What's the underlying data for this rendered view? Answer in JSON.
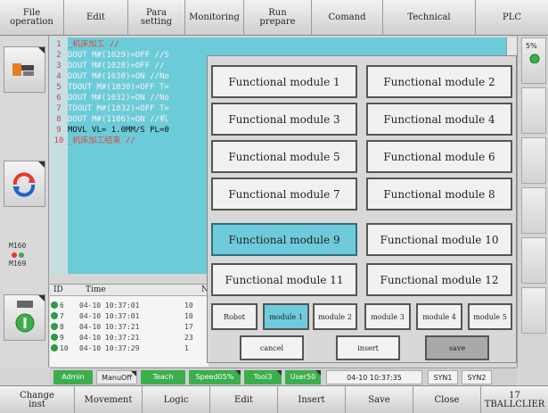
{
  "menu": [
    {
      "label": "File operation"
    },
    {
      "label": "Edit"
    },
    {
      "label": "Para\nsetting"
    },
    {
      "label": "Monitoring"
    },
    {
      "label": "Run\nprepare"
    },
    {
      "label": "Comand"
    },
    {
      "label": "Technical"
    },
    {
      "label": "PLC"
    }
  ],
  "left_tools": {
    "counter_top": "M160",
    "counter_bottom": "M169"
  },
  "right_col": {
    "speed": "5%"
  },
  "program": {
    "lines": [
      {
        "no": "1",
        "code": "_机床加工 //",
        "red": true
      },
      {
        "no": "2",
        "code": "DOUT M#(1029)=OFF //S"
      },
      {
        "no": "3",
        "code": "DOUT M#(1028)=OFF //"
      },
      {
        "no": "4",
        "code": "DOUT M#(1030)=ON //No"
      },
      {
        "no": "5",
        "code": "TDOUT M#(1030)=OFF T="
      },
      {
        "no": "6",
        "code": "DOUT M#(1032)=ON //No"
      },
      {
        "no": "7",
        "code": "TDOUT M#(1032)=OFF T="
      },
      {
        "no": "8",
        "code": "DOUT M#(1106)=ON //机"
      },
      {
        "no": "9",
        "code": "MOVL VL= 1.0MM/S PL=0"
      },
      {
        "no": "10",
        "code": "_机床加工结束 //",
        "red": true
      }
    ]
  },
  "log": {
    "headers": [
      "ID",
      "Time",
      "N"
    ],
    "rows": [
      {
        "id": "6",
        "time": "04-10 10:37:01",
        "n": "10"
      },
      {
        "id": "7",
        "time": "04-10 10:37:01",
        "n": "10"
      },
      {
        "id": "8",
        "time": "04-10 10:37:21",
        "n": "17"
      },
      {
        "id": "9",
        "time": "04-10 10:37:21",
        "n": "23"
      },
      {
        "id": "10",
        "time": "04-10 10:37:29",
        "n": "1"
      }
    ]
  },
  "dialog": {
    "modules": [
      "Functional module 1",
      "Functional module 2",
      "Functional module 3",
      "Functional module 4",
      "Functional module 5",
      "Functional module 6",
      "Functional module 7",
      "Functional module 8",
      "Functional module 9",
      "Functional module 10",
      "Functional module 11",
      "Functional module 12"
    ],
    "selected_module": 8,
    "tabs": [
      "Robot",
      "module 1",
      "module 2",
      "module 3",
      "module 4",
      "module 5"
    ],
    "selected_tab": 1,
    "actions": {
      "cancel": "cancel",
      "insert": "insert",
      "save": "save"
    }
  },
  "status": {
    "user": "Admin",
    "mode1": "ManuOff",
    "mode2": "Teach",
    "speed": "Speed05%",
    "tool": "Tool3",
    "userframe": "User50",
    "datetime": "04-10 10:37:35",
    "syn1": "SYN1",
    "syn2": "SYN2"
  },
  "bottom": [
    {
      "label": "Change\ninst"
    },
    {
      "label": "Movement"
    },
    {
      "label": "Logic"
    },
    {
      "label": "Edit"
    },
    {
      "label": "Insert"
    },
    {
      "label": "Save"
    },
    {
      "label": "Close"
    },
    {
      "label": "17\nTBALLCLIER"
    }
  ]
}
